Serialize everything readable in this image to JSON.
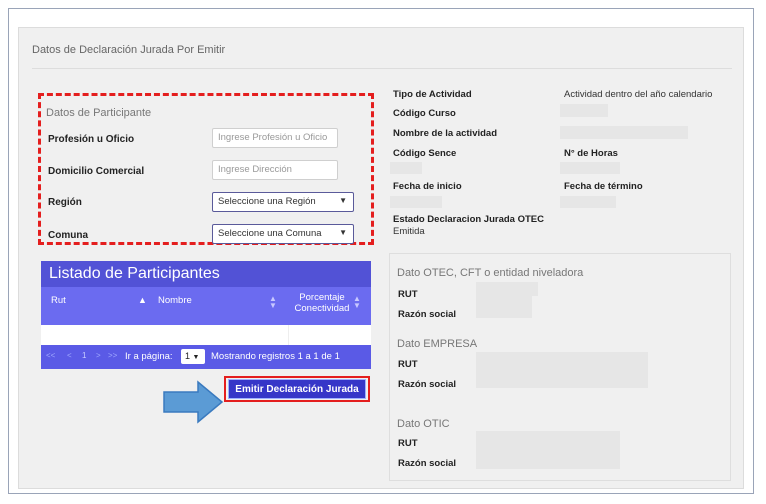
{
  "panel": {
    "title": "Datos de Declaración Jurada Por Emitir"
  },
  "participante": {
    "section_title": "Datos de Participante",
    "profesion_label": "Profesión u Oficio",
    "profesion_placeholder": "Ingrese Profesión u Oficio",
    "domicilio_label": "Domicilio Comercial",
    "domicilio_placeholder": "Ingrese Dirección",
    "region_label": "Región",
    "region_value": "Seleccione una Región",
    "comuna_label": "Comuna",
    "comuna_value": "Seleccione una Comuna"
  },
  "actividad": {
    "tipo_label": "Tipo de Actividad",
    "tipo_value": "Actividad dentro del año calendario",
    "codigo_curso_label": "Código Curso",
    "nombre_label": "Nombre de la actividad",
    "codigo_sence_label": "Código Sence",
    "horas_label": "N° de Horas",
    "inicio_label": "Fecha de inicio",
    "termino_label": "Fecha de término",
    "estado_label": "Estado Declaracion Jurada OTEC",
    "estado_value": "Emitida"
  },
  "listado": {
    "title": "Listado de Participantes",
    "columns": [
      "Rut",
      "Nombre",
      "Porcentaje Conectividad"
    ],
    "pagination": {
      "first": "<<",
      "prev": "<",
      "page": "1",
      "next": ">",
      "last": ">>",
      "goto_label": "Ir a página:",
      "goto_value": "1",
      "summary": "Mostrando registros 1 a 1 de 1"
    }
  },
  "emit_button": "Emitir Declaración Jurada",
  "right": {
    "otec_title": "Dato OTEC, CFT o entidad niveladora",
    "empresa_title": "Dato EMPRESA",
    "otic_title": "Dato OTIC",
    "rut_label": "RUT",
    "razon_label": "Razón social"
  },
  "colors": {
    "accent": "#5252d6",
    "highlight": "#e41e1e",
    "arrow": "#5b9bd5"
  }
}
